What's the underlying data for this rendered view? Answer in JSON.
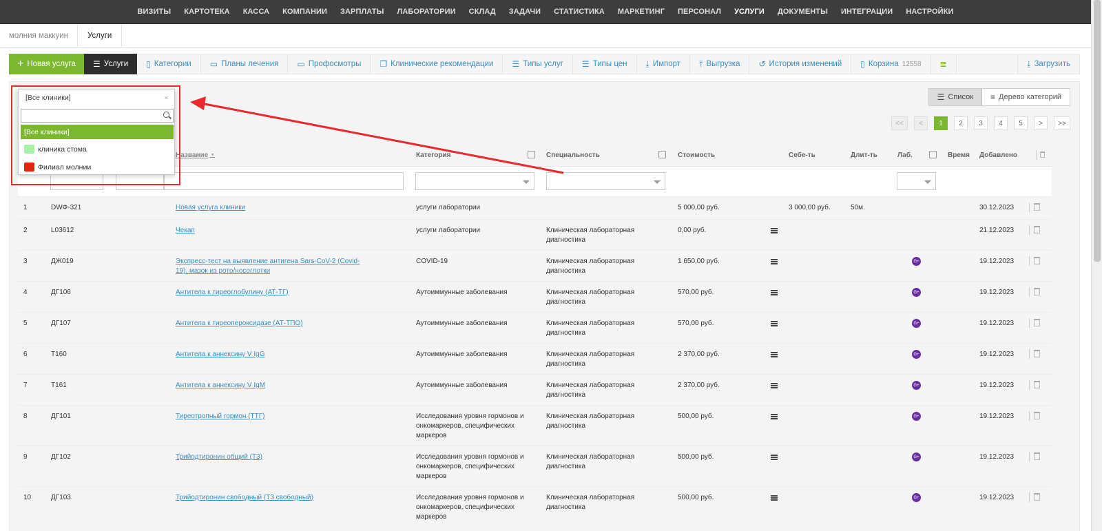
{
  "topnav": [
    "ВИЗИТЫ",
    "КАРТОТЕКА",
    "КАССА",
    "КОМПАНИИ",
    "ЗАРПЛАТЫ",
    "ЛАБОРАТОРИИ",
    "СКЛАД",
    "ЗАДАЧИ",
    "СТАТИСТИКА",
    "МАРКЕТИНГ",
    "ПЕРСОНАЛ",
    "УСЛУГИ",
    "ДОКУМЕНТЫ",
    "ИНТЕГРАЦИИ",
    "НАСТРОЙКИ"
  ],
  "topnav_active": "УСЛУГИ",
  "breadcrumb": {
    "clinic": "молния маккуин",
    "current": "Услуги"
  },
  "toolbar": {
    "new_service": "Новая услуга",
    "services": "Услуги",
    "categories": "Категории",
    "treatment_plans": "Планы лечения",
    "checkups": "Профосмотры",
    "clinical_recs": "Клинические рекомендации",
    "service_types": "Типы услуг",
    "price_types": "Типы цен",
    "import": "Импорт",
    "export": "Выгрузка",
    "history": "История изменений",
    "trash": "Корзина",
    "trash_count": "12558",
    "download": "Загрузить"
  },
  "view": {
    "list": "Список",
    "tree": "Дерево категорий",
    "active": "list"
  },
  "pager": [
    "<<",
    "<",
    "1",
    "2",
    "3",
    "4",
    "5",
    ">",
    ">>"
  ],
  "pager_active": "1",
  "columns": {
    "name": "Название",
    "category": "Категория",
    "specialty": "Специальность",
    "cost": "Стоимость",
    "selfcost": "Себе-ть",
    "duration": "Длит-ть",
    "lab": "Лаб.",
    "time": "Время",
    "added": "Добавлено"
  },
  "dropdown": {
    "selected": "[Все клиники]",
    "options": [
      {
        "label": "[Все клиники]",
        "color": ""
      },
      {
        "label": "клиника стома",
        "color": "#a8f0a8"
      },
      {
        "label": "Филиал молнии",
        "color": "#e0260e"
      }
    ]
  },
  "rows": [
    {
      "n": "1",
      "code": "DWФ-321",
      "name": "Новая услуга клиники",
      "category": "услуги лаборатории",
      "specialty": "",
      "cost": "5 000,00 руб.",
      "list": false,
      "selfcost": "3 000,00 руб.",
      "duration": "50м.",
      "lab": false,
      "added": "30.12.2023"
    },
    {
      "n": "2",
      "code": "L03612",
      "name": "Чекап",
      "category": "услуги лаборатории",
      "specialty": "Клиническая лабораторная диагностика",
      "cost": "0,00 руб.",
      "list": true,
      "selfcost": "",
      "duration": "",
      "lab": false,
      "added": "21.12.2023"
    },
    {
      "n": "3",
      "code": "ДЖ019",
      "name": "Экспресс-тест на выявление антигена Sars-CoV-2 (Covid-19), мазок из рото/носоглотки",
      "category": "COVID-19",
      "specialty": "Клиническая лабораторная диагностика",
      "cost": "1 650,00 руб.",
      "list": true,
      "selfcost": "",
      "duration": "",
      "lab": true,
      "added": "19.12.2023"
    },
    {
      "n": "4",
      "code": "ДГ106",
      "name": "Антитела к тиреоглобулину (АТ-ТГ)",
      "category": "Аутоиммунные заболевания",
      "specialty": "Клиническая лабораторная диагностика",
      "cost": "570,00 руб.",
      "list": true,
      "selfcost": "",
      "duration": "",
      "lab": true,
      "added": "19.12.2023"
    },
    {
      "n": "5",
      "code": "ДГ107",
      "name": "Антитела к тиреопероксидазе (АТ-ТПО)",
      "category": "Аутоиммунные заболевания",
      "specialty": "Клиническая лабораторная диагностика",
      "cost": "570,00 руб.",
      "list": true,
      "selfcost": "",
      "duration": "",
      "lab": true,
      "added": "19.12.2023"
    },
    {
      "n": "6",
      "code": "T160",
      "name": "Антитела к аннексину V IgG",
      "category": "Аутоиммунные заболевания",
      "specialty": "Клиническая лабораторная диагностика",
      "cost": "2 370,00 руб.",
      "list": true,
      "selfcost": "",
      "duration": "",
      "lab": true,
      "added": "19.12.2023"
    },
    {
      "n": "7",
      "code": "T161",
      "name": "Антитела к аннексину V IgM",
      "category": "Аутоиммунные заболевания",
      "specialty": "Клиническая лабораторная диагностика",
      "cost": "2 370,00 руб.",
      "list": true,
      "selfcost": "",
      "duration": "",
      "lab": true,
      "added": "19.12.2023"
    },
    {
      "n": "8",
      "code": "ДГ101",
      "name": "Тиреотропный гормон (ТТГ)",
      "category": "Исследования уровня гормонов и онкомаркеров, специфических маркеров",
      "specialty": "Клиническая лабораторная диагностика",
      "cost": "500,00 руб.",
      "list": true,
      "selfcost": "",
      "duration": "",
      "lab": true,
      "added": "19.12.2023"
    },
    {
      "n": "9",
      "code": "ДГ102",
      "name": "Трийодтиронин общий (Т3)",
      "category": "Исследования уровня гормонов и онкомаркеров, специфических маркеров",
      "specialty": "Клиническая лабораторная диагностика",
      "cost": "500,00 руб.",
      "list": true,
      "selfcost": "",
      "duration": "",
      "lab": true,
      "added": "19.12.2023"
    },
    {
      "n": "10",
      "code": "ДГ103",
      "name": "Трийодтиронин свободный (Т3 свободный)",
      "category": "Исследования уровня гормонов и онкомаркеров, специфических маркеров",
      "specialty": "Клиническая лабораторная диагностика",
      "cost": "500,00 руб.",
      "list": true,
      "selfcost": "",
      "duration": "",
      "lab": true,
      "added": "19.12.2023"
    }
  ],
  "colors": {
    "accent": "#7cb82f",
    "link": "#3a8ec3",
    "nav_bg": "#3d3d3d",
    "lab_badge": "#6a2fa0",
    "annotation": "#e8292f"
  },
  "lab_badge_text": "G+"
}
